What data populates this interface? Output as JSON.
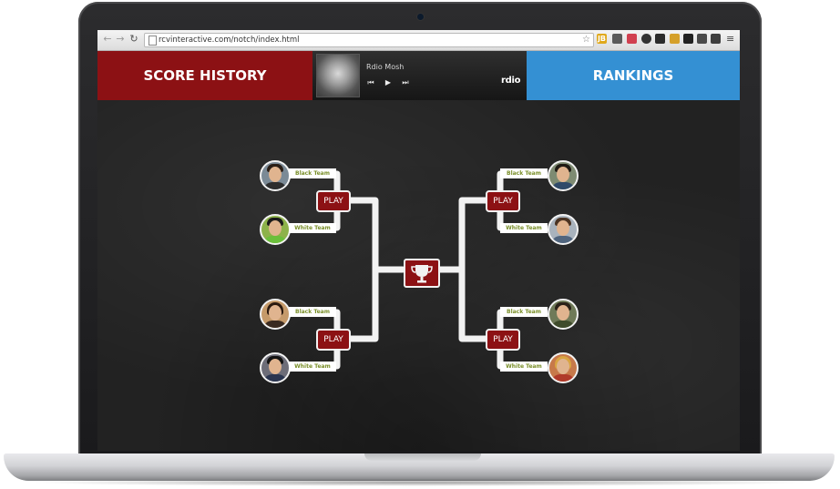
{
  "browser": {
    "url": "rcvinteractive.com/notch/index.html",
    "extensions": [
      {
        "name": "jb-extension-icon",
        "text": "JB",
        "color": "#e0a91c"
      },
      {
        "name": "eyedropper-extension-icon",
        "text": "",
        "color": "#5b5b5b"
      },
      {
        "name": "pocket-extension-icon",
        "text": "",
        "color": "#d14050"
      },
      {
        "name": "ghostery-extension-icon",
        "text": "",
        "color": "#333333"
      },
      {
        "name": "shield-extension-icon",
        "text": "",
        "color": "#2b2b2b"
      },
      {
        "name": "hootsuite-extension-icon",
        "text": "",
        "color": "#d5a02a"
      },
      {
        "name": "buffer-extension-icon",
        "text": "",
        "color": "#222222"
      },
      {
        "name": "layers-extension-icon",
        "text": "",
        "color": "#4a4a4a"
      },
      {
        "name": "evernote-extension-icon",
        "text": "",
        "color": "#3e3e3e"
      }
    ]
  },
  "header": {
    "score_history_label": "SCORE HISTORY",
    "rankings_label": "RANKINGS"
  },
  "player": {
    "track_title": "Rdio Mosh",
    "prev_symbol": "⏮",
    "play_symbol": "▶",
    "next_symbol": "⏭",
    "brand": "rdio"
  },
  "bracket": {
    "play_label": "PLAY",
    "team_black": "Black Team",
    "team_white": "White Team"
  },
  "colors": {
    "accent_red": "#8c1114",
    "accent_blue": "#3490d3",
    "team_label_text": "#7a8f2a"
  }
}
